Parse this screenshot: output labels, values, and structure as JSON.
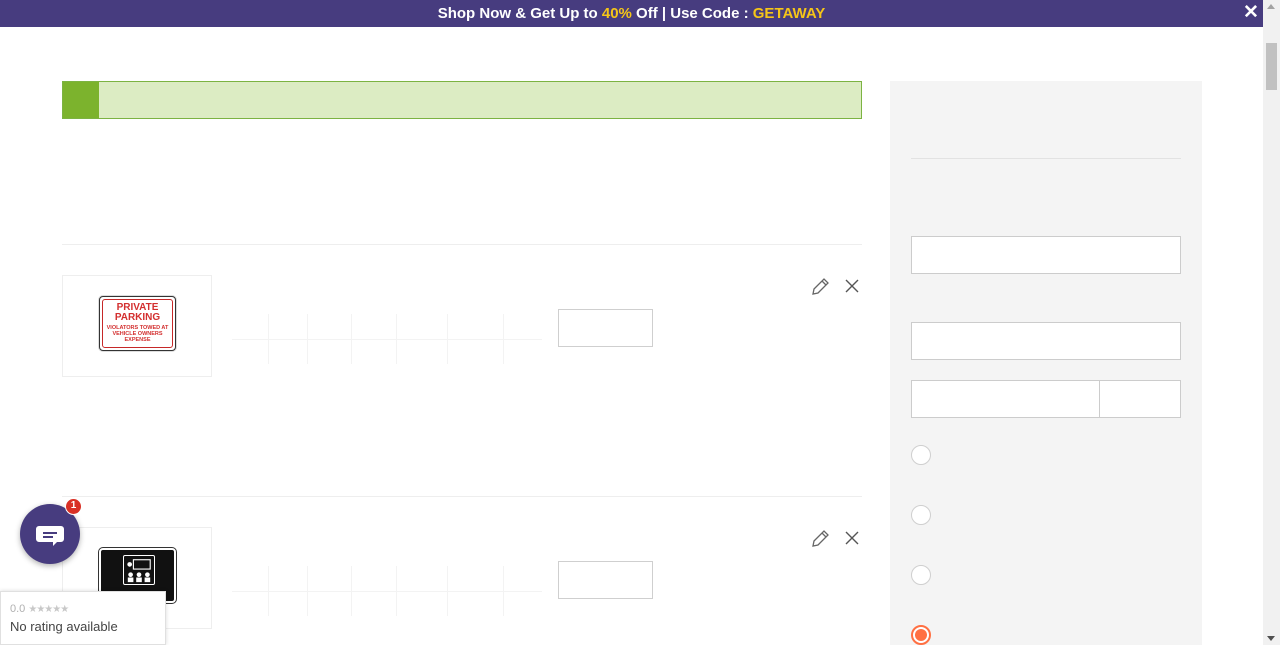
{
  "promo": {
    "prefix": "Shop Now & Get Up to ",
    "discount": "40%",
    "middle": " Off | Use Code : ",
    "code": "GETAWAY",
    "close_glyph": "✕"
  },
  "progress": {
    "fill_fraction": 0.045
  },
  "cart_items": [
    {
      "sign": {
        "title": "PRIVATE PARKING",
        "subtitle": "VIOLATORS TOWED AT VEHICLE OWNERS EXPENSE"
      }
    },
    {
      "sign": {
        "icon": "presentation-icon"
      }
    }
  ],
  "chat": {
    "badge_count": "1"
  },
  "rating_widget": {
    "score": "0.0",
    "stars": "★★★★★",
    "text": "No rating available"
  },
  "colors": {
    "promo_bg": "#473c7f",
    "promo_highlight": "#f5c518",
    "progress_fill": "#7cb32d",
    "progress_bg": "#dcecc3",
    "radio_selected": "#ff7043"
  }
}
